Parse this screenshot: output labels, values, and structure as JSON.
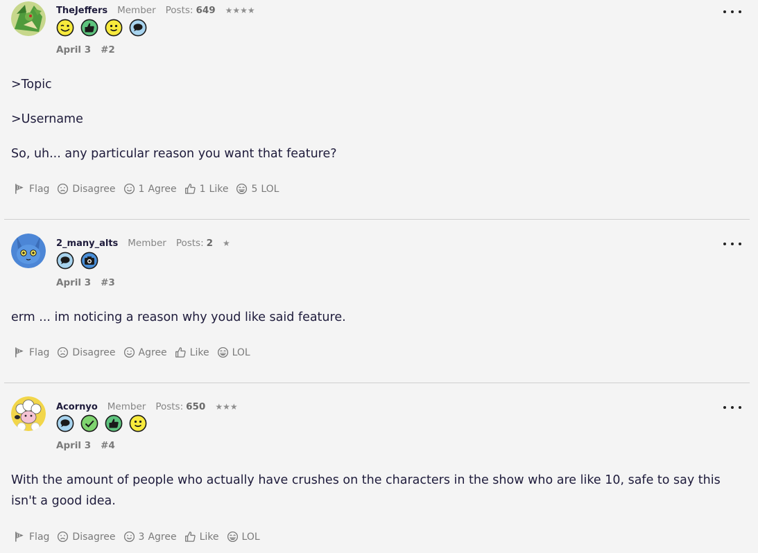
{
  "posts": [
    {
      "username": "TheJeffers",
      "role": "Member",
      "posts_label": "Posts:",
      "posts_count": "649",
      "stars": "★★★★",
      "badges": [
        "wink-emoji",
        "thumbs-up",
        "smile-emoji",
        "speech-bubble"
      ],
      "date": "April 3",
      "post_number": "#2",
      "paragraphs": [
        ">Topic",
        ">Username",
        "So, uh... any particular reason you want that feature?"
      ],
      "reactions": {
        "flag": "Flag",
        "disagree": "Disagree",
        "agree_count": "1",
        "agree": "Agree",
        "like_count": "1",
        "like": "Like",
        "lol_count": "5",
        "lol": "LOL"
      }
    },
    {
      "username": "2_many_alts",
      "role": "Member",
      "posts_label": "Posts:",
      "posts_count": "2",
      "stars": "★",
      "badges": [
        "speech-bubble",
        "camera"
      ],
      "date": "April 3",
      "post_number": "#3",
      "paragraphs": [
        "erm ... im noticing a reason why youd like said feature."
      ],
      "reactions": {
        "flag": "Flag",
        "disagree": "Disagree",
        "agree": "Agree",
        "like": "Like",
        "lol": "LOL"
      }
    },
    {
      "username": "Acornyo",
      "role": "Member",
      "posts_label": "Posts:",
      "posts_count": "650",
      "stars": "★★★",
      "badges": [
        "speech-bubble",
        "checkmark",
        "thumbs-up",
        "smile-emoji"
      ],
      "date": "April 3",
      "post_number": "#4",
      "paragraphs": [
        "With the amount of people who actually have crushes on the characters in the show who are like 10, safe to say this isn't a good idea."
      ],
      "reactions": {
        "flag": "Flag",
        "disagree": "Disagree",
        "agree_count": "3",
        "agree": "Agree",
        "like": "Like",
        "lol": "LOL"
      }
    }
  ],
  "colors": {
    "background": "#f4f4f4",
    "text": "#1e1b3b",
    "muted": "#7a7a7a",
    "divider": "#cfcfcf"
  }
}
